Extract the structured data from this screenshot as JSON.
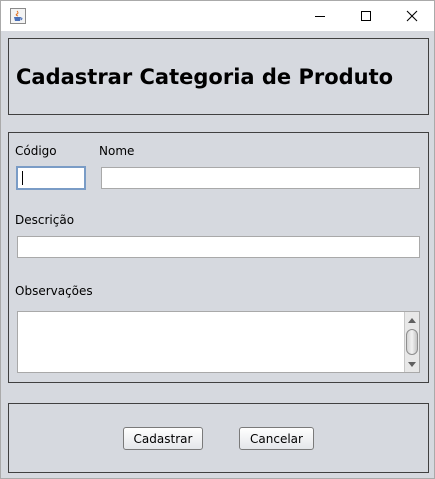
{
  "window": {
    "icon": "java-coffee-cup-icon",
    "controls": [
      "minimize-icon",
      "maximize-icon",
      "close-icon"
    ]
  },
  "header": {
    "title": "Cadastrar Categoria de Produto"
  },
  "form": {
    "codigo": {
      "label": "Código",
      "value": ""
    },
    "nome": {
      "label": "Nome",
      "value": ""
    },
    "descricao": {
      "label": "Descrição",
      "value": ""
    },
    "observacoes": {
      "label": "Observações",
      "value": ""
    }
  },
  "buttons": {
    "cadastrar": "Cadastrar",
    "cancelar": "Cancelar"
  }
}
